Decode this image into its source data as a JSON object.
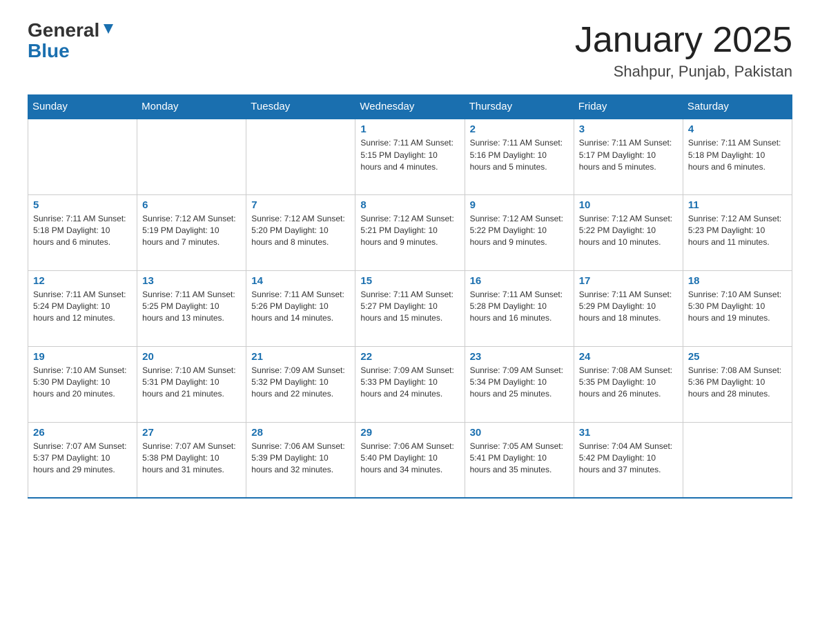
{
  "header": {
    "logo_general": "General",
    "logo_blue": "Blue",
    "month_title": "January 2025",
    "location": "Shahpur, Punjab, Pakistan"
  },
  "days_of_week": [
    "Sunday",
    "Monday",
    "Tuesday",
    "Wednesday",
    "Thursday",
    "Friday",
    "Saturday"
  ],
  "weeks": [
    [
      {
        "day": "",
        "info": ""
      },
      {
        "day": "",
        "info": ""
      },
      {
        "day": "",
        "info": ""
      },
      {
        "day": "1",
        "info": "Sunrise: 7:11 AM\nSunset: 5:15 PM\nDaylight: 10 hours\nand 4 minutes."
      },
      {
        "day": "2",
        "info": "Sunrise: 7:11 AM\nSunset: 5:16 PM\nDaylight: 10 hours\nand 5 minutes."
      },
      {
        "day": "3",
        "info": "Sunrise: 7:11 AM\nSunset: 5:17 PM\nDaylight: 10 hours\nand 5 minutes."
      },
      {
        "day": "4",
        "info": "Sunrise: 7:11 AM\nSunset: 5:18 PM\nDaylight: 10 hours\nand 6 minutes."
      }
    ],
    [
      {
        "day": "5",
        "info": "Sunrise: 7:11 AM\nSunset: 5:18 PM\nDaylight: 10 hours\nand 6 minutes."
      },
      {
        "day": "6",
        "info": "Sunrise: 7:12 AM\nSunset: 5:19 PM\nDaylight: 10 hours\nand 7 minutes."
      },
      {
        "day": "7",
        "info": "Sunrise: 7:12 AM\nSunset: 5:20 PM\nDaylight: 10 hours\nand 8 minutes."
      },
      {
        "day": "8",
        "info": "Sunrise: 7:12 AM\nSunset: 5:21 PM\nDaylight: 10 hours\nand 9 minutes."
      },
      {
        "day": "9",
        "info": "Sunrise: 7:12 AM\nSunset: 5:22 PM\nDaylight: 10 hours\nand 9 minutes."
      },
      {
        "day": "10",
        "info": "Sunrise: 7:12 AM\nSunset: 5:22 PM\nDaylight: 10 hours\nand 10 minutes."
      },
      {
        "day": "11",
        "info": "Sunrise: 7:12 AM\nSunset: 5:23 PM\nDaylight: 10 hours\nand 11 minutes."
      }
    ],
    [
      {
        "day": "12",
        "info": "Sunrise: 7:11 AM\nSunset: 5:24 PM\nDaylight: 10 hours\nand 12 minutes."
      },
      {
        "day": "13",
        "info": "Sunrise: 7:11 AM\nSunset: 5:25 PM\nDaylight: 10 hours\nand 13 minutes."
      },
      {
        "day": "14",
        "info": "Sunrise: 7:11 AM\nSunset: 5:26 PM\nDaylight: 10 hours\nand 14 minutes."
      },
      {
        "day": "15",
        "info": "Sunrise: 7:11 AM\nSunset: 5:27 PM\nDaylight: 10 hours\nand 15 minutes."
      },
      {
        "day": "16",
        "info": "Sunrise: 7:11 AM\nSunset: 5:28 PM\nDaylight: 10 hours\nand 16 minutes."
      },
      {
        "day": "17",
        "info": "Sunrise: 7:11 AM\nSunset: 5:29 PM\nDaylight: 10 hours\nand 18 minutes."
      },
      {
        "day": "18",
        "info": "Sunrise: 7:10 AM\nSunset: 5:30 PM\nDaylight: 10 hours\nand 19 minutes."
      }
    ],
    [
      {
        "day": "19",
        "info": "Sunrise: 7:10 AM\nSunset: 5:30 PM\nDaylight: 10 hours\nand 20 minutes."
      },
      {
        "day": "20",
        "info": "Sunrise: 7:10 AM\nSunset: 5:31 PM\nDaylight: 10 hours\nand 21 minutes."
      },
      {
        "day": "21",
        "info": "Sunrise: 7:09 AM\nSunset: 5:32 PM\nDaylight: 10 hours\nand 22 minutes."
      },
      {
        "day": "22",
        "info": "Sunrise: 7:09 AM\nSunset: 5:33 PM\nDaylight: 10 hours\nand 24 minutes."
      },
      {
        "day": "23",
        "info": "Sunrise: 7:09 AM\nSunset: 5:34 PM\nDaylight: 10 hours\nand 25 minutes."
      },
      {
        "day": "24",
        "info": "Sunrise: 7:08 AM\nSunset: 5:35 PM\nDaylight: 10 hours\nand 26 minutes."
      },
      {
        "day": "25",
        "info": "Sunrise: 7:08 AM\nSunset: 5:36 PM\nDaylight: 10 hours\nand 28 minutes."
      }
    ],
    [
      {
        "day": "26",
        "info": "Sunrise: 7:07 AM\nSunset: 5:37 PM\nDaylight: 10 hours\nand 29 minutes."
      },
      {
        "day": "27",
        "info": "Sunrise: 7:07 AM\nSunset: 5:38 PM\nDaylight: 10 hours\nand 31 minutes."
      },
      {
        "day": "28",
        "info": "Sunrise: 7:06 AM\nSunset: 5:39 PM\nDaylight: 10 hours\nand 32 minutes."
      },
      {
        "day": "29",
        "info": "Sunrise: 7:06 AM\nSunset: 5:40 PM\nDaylight: 10 hours\nand 34 minutes."
      },
      {
        "day": "30",
        "info": "Sunrise: 7:05 AM\nSunset: 5:41 PM\nDaylight: 10 hours\nand 35 minutes."
      },
      {
        "day": "31",
        "info": "Sunrise: 7:04 AM\nSunset: 5:42 PM\nDaylight: 10 hours\nand 37 minutes."
      },
      {
        "day": "",
        "info": ""
      }
    ]
  ]
}
